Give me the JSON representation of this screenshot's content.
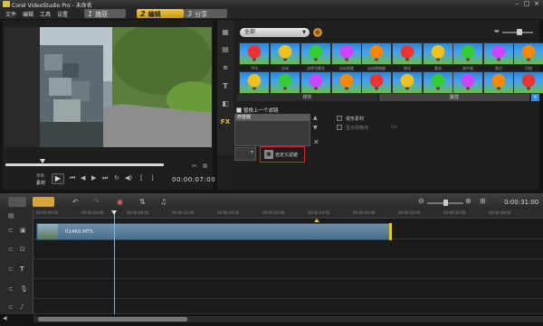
{
  "window": {
    "title": "Corel VideoStudio Pro - 未命名"
  },
  "menu": {
    "items": [
      "文件",
      "编辑",
      "工具",
      "设置"
    ]
  },
  "steps": [
    {
      "num": "1",
      "label": "捕获"
    },
    {
      "num": "2",
      "label": "编辑"
    },
    {
      "num": "3",
      "label": "分享"
    }
  ],
  "player": {
    "project_label": "项目",
    "clip_label": "素材",
    "timecode": "00:00:07:00"
  },
  "library": {
    "filter_dropdown": "全部",
    "tabs": {
      "media": "媒体",
      "attributes": "属性"
    },
    "thumb_labels": [
      "平均",
      "自动",
      "去除马赛克",
      "自动亮度",
      "自动饱和度",
      "锐化",
      "柔化",
      "画中画",
      "雨点",
      "闪电",
      "图像",
      "铅笔"
    ]
  },
  "attributes": {
    "replace_last_filter": "替换上一个滤镜",
    "filter_item": "修整器",
    "deform_clip": "变形素材",
    "show_grid": "显示网格线",
    "custom_filter": "自定义滤镜"
  },
  "timeline": {
    "timecode": "0:00:31:00",
    "clip_name": "01460.MTS",
    "ruler_ticks": [
      "00:00:00:00",
      "00:00:04:00",
      "00:00:08:00",
      "00:00:12:00",
      "00:00:16:00",
      "00:00:20:00",
      "00:00:24:00",
      "00:00:28:00",
      "00:00:32:00",
      "00:00:36:00",
      "00:00:40:00"
    ]
  },
  "colors": {
    "accent": "#f0c64a",
    "highlight_box": "#e02020",
    "clip": "#5c7f9c"
  }
}
